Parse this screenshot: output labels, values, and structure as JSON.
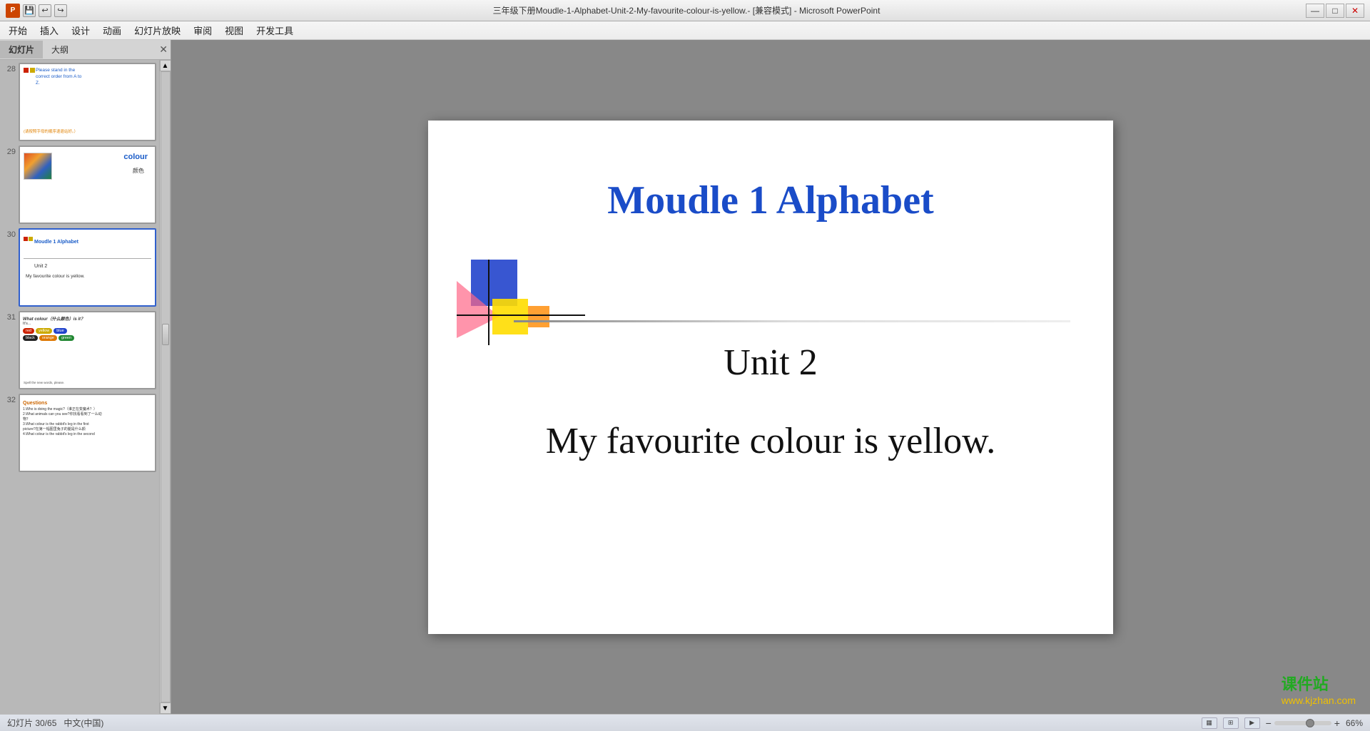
{
  "titlebar": {
    "title": "三年级下册Moudle-1-Alphabet-Unit-2-My-favourite-colour-is-yellow.- [兼容模式] - Microsoft PowerPoint",
    "app_name": "P"
  },
  "menubar": {
    "items": [
      "开始",
      "插入",
      "设计",
      "动画",
      "幻灯片放映",
      "审阅",
      "视图",
      "开发工具"
    ]
  },
  "panel_tabs": [
    "幻灯片",
    "大纲"
  ],
  "slides": [
    {
      "num": "28",
      "text_line1": "Please stand in the",
      "text_line2": "correct order from A to",
      "text_line3": "Z.",
      "text_sub": "(请按照字母的顺序退退站好。）"
    },
    {
      "num": "29",
      "word": "colour",
      "cn": "颜色"
    },
    {
      "num": "30",
      "title": "Moudle 1 Alphabet",
      "unit": "Unit  2",
      "subtitle": "My favourite colour is yellow.",
      "selected": true
    },
    {
      "num": "31",
      "title": "What colour（什么颜色）is it？",
      "its": "It's...",
      "colors": [
        {
          "label": "red",
          "bg": "#cc2200"
        },
        {
          "label": "yellow",
          "bg": "#ccaa00"
        },
        {
          "label": "blue",
          "bg": "#2244cc"
        },
        {
          "label": "black",
          "bg": "#222222"
        },
        {
          "label": "orange",
          "bg": "#dd7700"
        },
        {
          "label": "green",
          "bg": "#228833"
        }
      ],
      "footer": "Spell the new words, please."
    },
    {
      "num": "32",
      "title": "Questions",
      "q1": "1.Who is doing the magic?（谁正在变魔术？）",
      "q2": "2.What animals can you see?你找看到了一么动物？",
      "q3": "3.What colour is the rabbit's leg in the first picture?在第一幅图里兔子的腿是什么颜色",
      "q4": "4.What colour is the rabbit's leg in the second"
    }
  ],
  "current_slide": {
    "title": "Moudle 1 Alphabet",
    "unit": "Unit  2",
    "subtitle": "My favourite colour is yellow."
  },
  "statusbar": {
    "slide_count": "幻灯片 30/65",
    "language": "中文(中国)",
    "zoom": "66%"
  },
  "watermark": {
    "line1": "课件站",
    "line2": "www.kjzhan.com"
  },
  "window_controls": [
    "—",
    "□",
    "✕"
  ]
}
